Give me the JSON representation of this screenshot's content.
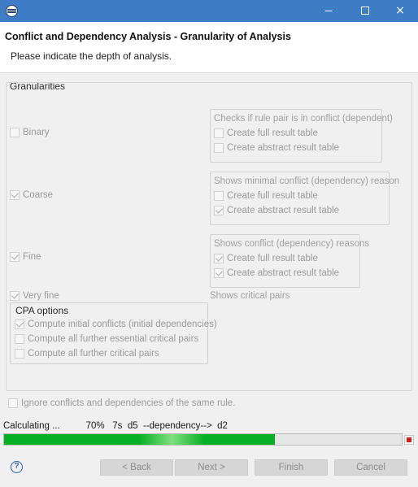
{
  "window": {
    "controls": {
      "minimize": "minimize",
      "maximize": "maximize",
      "close": "×"
    }
  },
  "header": {
    "title": "Conflict and Dependency Analysis - Granularity of Analysis",
    "description": "Please indicate the depth of analysis."
  },
  "granularities": {
    "label": "Granularities",
    "binary": {
      "label": "Binary",
      "checked": false,
      "group_label": "Checks if rule pair is in conflict (dependent)",
      "full_table": {
        "label": "Create full result table",
        "checked": false
      },
      "abstract_table": {
        "label": "Create abstract result table",
        "checked": false
      }
    },
    "coarse": {
      "label": "Coarse",
      "checked": true,
      "group_label": "Shows minimal conflict (dependency) reason",
      "full_table": {
        "label": "Create full result table",
        "checked": false
      },
      "abstract_table": {
        "label": "Create abstract result table",
        "checked": true
      }
    },
    "fine": {
      "label": "Fine",
      "checked": true,
      "group_label": "Shows conflict (dependency) reasons",
      "full_table": {
        "label": "Create full result table",
        "checked": true
      },
      "abstract_table": {
        "label": "Create abstract result table",
        "checked": true
      }
    },
    "very_fine": {
      "label": "Very fine",
      "checked": true,
      "note": "Shows critical pairs"
    },
    "cpa": {
      "label": "CPA options",
      "initial_conflicts": {
        "label": "Compute initial conflicts (initial dependencies)",
        "checked": true
      },
      "essential_pairs": {
        "label": "Compute all further essential critical pairs",
        "checked": false
      },
      "critical_pairs": {
        "label": "Compute all further critical pairs",
        "checked": false
      }
    }
  },
  "ignore_same_rule": {
    "label": "Ignore conflicts and dependencies of the same rule.",
    "checked": false
  },
  "status": {
    "text": "Calculating ...",
    "percent": "70%",
    "time": "7s",
    "detail": "d5  --dependency-->  d2",
    "progress": 0.68
  },
  "buttons": {
    "back": "< Back",
    "next": "Next >",
    "finish": "Finish",
    "cancel": "Cancel",
    "help": "?"
  },
  "colors": {
    "titlebar": "#3f7cc6",
    "progress_fill": "#06b025",
    "stop": "#d21f1f"
  }
}
